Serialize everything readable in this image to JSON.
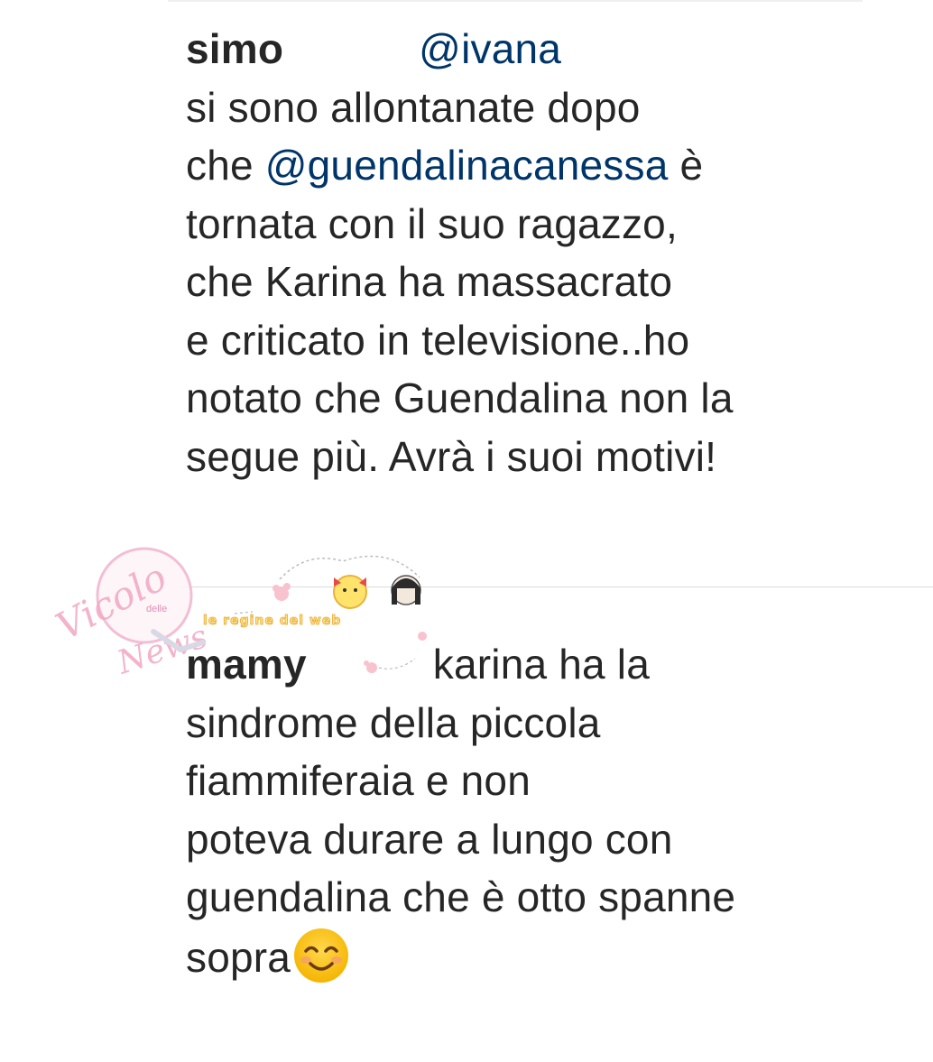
{
  "comments": [
    {
      "username": "simo",
      "mention": "@ivana",
      "lines": {
        "l1": "si sono allontanate dopo",
        "l2_pre": "che ",
        "l2_mention": "@guendalinacanessa",
        "l2_post": " è",
        "l3": "tornata con il suo ragazzo,",
        "l4": "che Karina ha massacrato",
        "l5": "e criticato in televisione..ho",
        "l6": "notato che Guendalina non la",
        "l7": "segue più. Avrà i suoi motivi!"
      }
    },
    {
      "username": "mamy",
      "lines": {
        "l1": "karina ha la",
        "l2": "sindrome della piccola",
        "l3": "fiammiferaia e non",
        "l4": "poteva durare a lungo con",
        "l5": "guendalina che è otto spanne",
        "l6": "sopra"
      },
      "emoji": "smiling-face-with-smiling-eyes-icon"
    }
  ],
  "watermark": {
    "logo_text_1": "Vicolo",
    "logo_text_small": "delle",
    "logo_text_2": "News",
    "banner_text": "le regine del web"
  },
  "colors": {
    "text": "#262626",
    "mention": "#003569",
    "divider": "#dbdbdb",
    "watermark_pink": "#f2a7c3"
  }
}
